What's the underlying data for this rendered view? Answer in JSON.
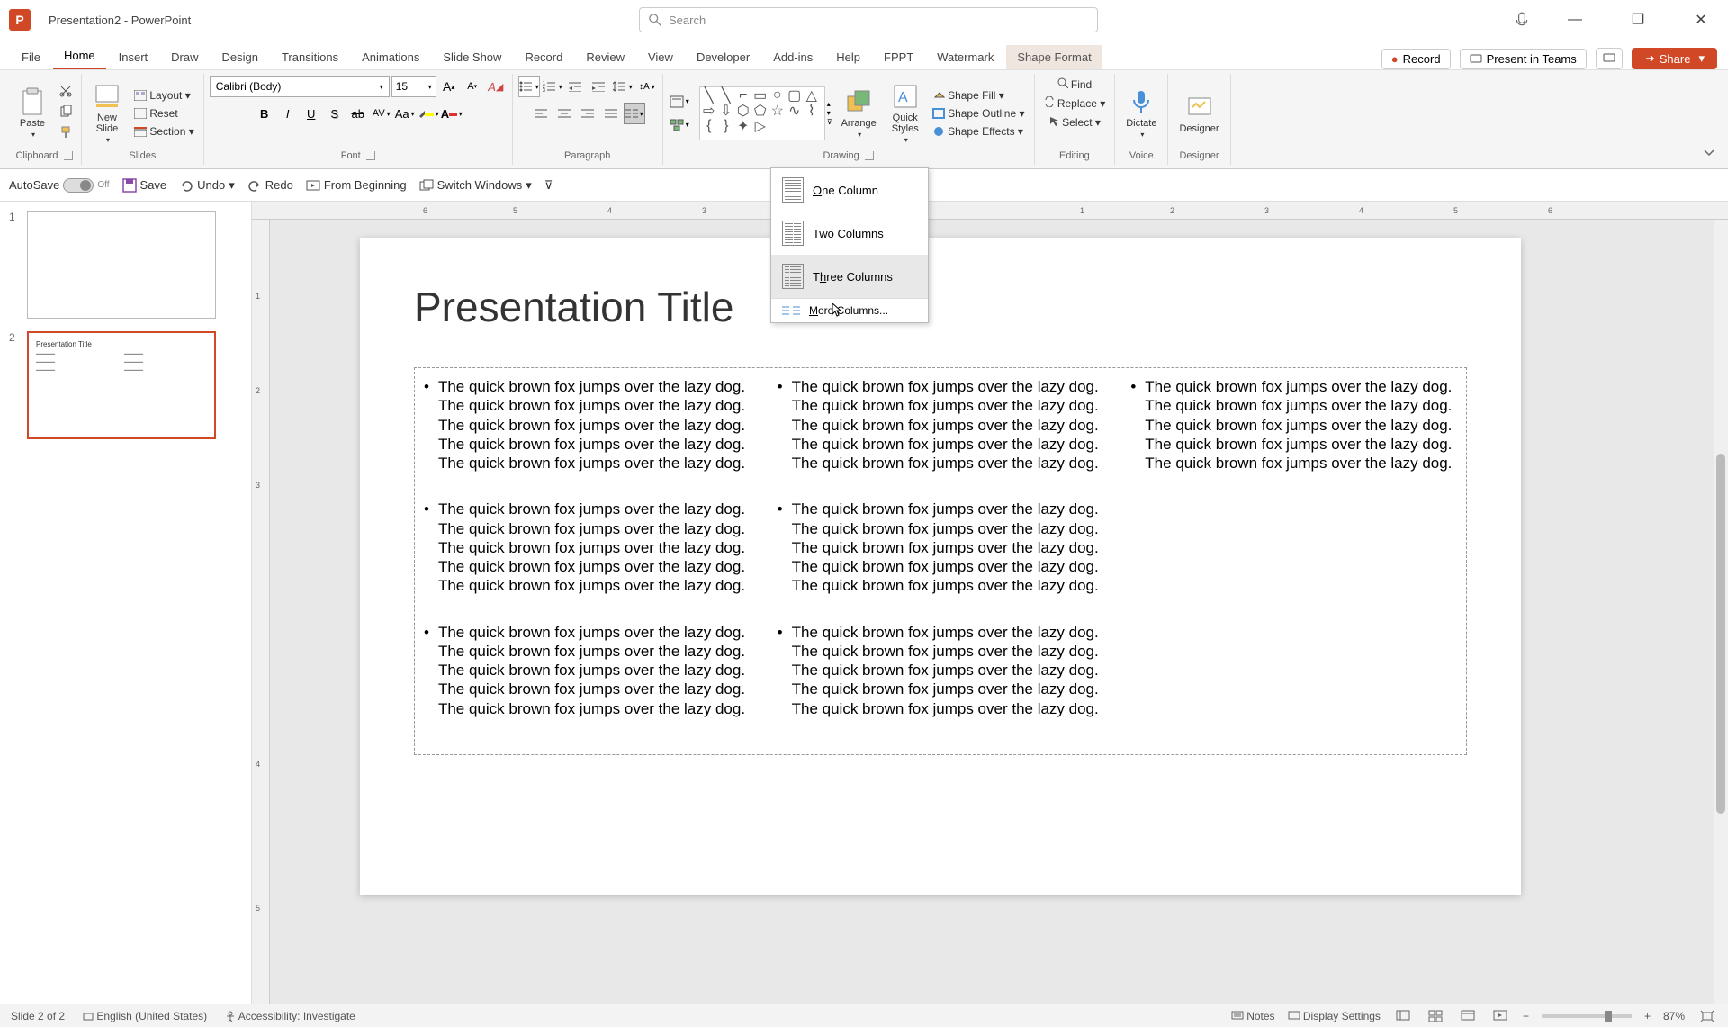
{
  "app": {
    "icon_letter": "P",
    "title": "Presentation2 - PowerPoint",
    "search_placeholder": "Search"
  },
  "window_controls": {
    "minimize": "—",
    "maximize": "❐",
    "close": "✕"
  },
  "tabs": {
    "file": "File",
    "home": "Home",
    "insert": "Insert",
    "draw": "Draw",
    "design": "Design",
    "transitions": "Transitions",
    "animations": "Animations",
    "slideshow": "Slide Show",
    "record_tab": "Record",
    "review": "Review",
    "view": "View",
    "developer": "Developer",
    "addins": "Add-ins",
    "help": "Help",
    "fppt": "FPPT",
    "watermark": "Watermark",
    "shape_format": "Shape Format"
  },
  "tab_right": {
    "record": "Record",
    "present": "Present in Teams",
    "share": "Share"
  },
  "ribbon": {
    "clipboard": {
      "paste": "Paste",
      "cut": "Cut",
      "copy": "Copy",
      "format_painter": "Format Painter",
      "label": "Clipboard"
    },
    "slides": {
      "new_slide": "New\nSlide",
      "layout": "Layout",
      "reset": "Reset",
      "section": "Section",
      "label": "Slides"
    },
    "font": {
      "name": "Calibri (Body)",
      "size": "15",
      "bold": "B",
      "italic": "I",
      "underline": "U",
      "strike": "S",
      "strikethrough": "ab",
      "spacing": "AV",
      "case": "Aa",
      "increase": "A",
      "decrease": "A",
      "clear": "A",
      "label": "Font"
    },
    "paragraph": {
      "label": "Paragraph"
    },
    "drawing": {
      "arrange": "Arrange",
      "quick_styles": "Quick\nStyles",
      "shape_fill": "Shape Fill",
      "shape_outline": "Shape Outline",
      "shape_effects": "Shape Effects",
      "label": "Drawing"
    },
    "editing": {
      "find": "Find",
      "replace": "Replace",
      "select": "Select",
      "label": "Editing"
    },
    "voice": {
      "dictate": "Dictate",
      "label": "Voice"
    },
    "designer": {
      "designer": "Designer",
      "label": "Designer"
    }
  },
  "qat": {
    "autosave": "AutoSave",
    "autosave_state": "Off",
    "save": "Save",
    "undo": "Undo",
    "redo": "Redo",
    "from_beginning": "From Beginning",
    "switch_windows": "Switch Windows"
  },
  "columns_menu": {
    "one": "One Column",
    "two": "Two Columns",
    "three": "Three Columns",
    "more": "More Columns..."
  },
  "slide": {
    "title": "Presentation Title",
    "bullet_text": "The quick brown fox jumps over the lazy dog. The quick brown fox jumps over the lazy dog. The quick brown fox jumps over the lazy dog. The quick brown fox jumps over the lazy dog. The quick brown fox jumps over the lazy dog."
  },
  "thumbnails": {
    "slide1_num": "1",
    "slide2_num": "2",
    "slide2_title": "Presentation Title"
  },
  "ruler": {
    "marks": [
      "6",
      "5",
      "4",
      "3",
      "1",
      "2",
      "3",
      "4",
      "5",
      "6"
    ],
    "vmarks": [
      "1",
      "2",
      "3",
      "4",
      "5"
    ]
  },
  "statusbar": {
    "slide_info": "Slide 2 of 2",
    "language": "English (United States)",
    "accessibility": "Accessibility: Investigate",
    "notes": "Notes",
    "display_settings": "Display Settings",
    "zoom": "87%"
  }
}
